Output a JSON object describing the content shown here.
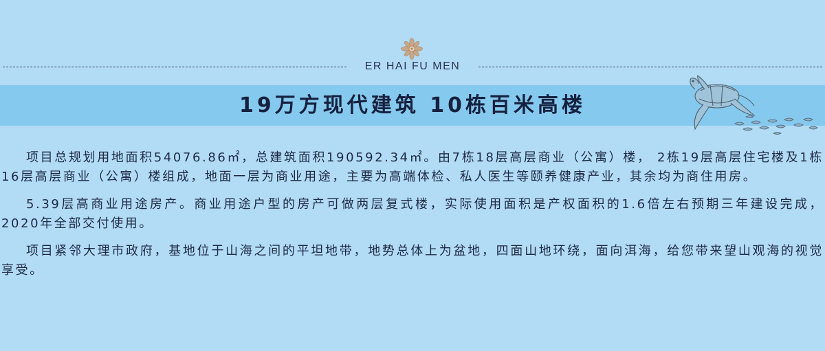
{
  "header": {
    "brand_text": "ER HAI FU MEN",
    "emblem_icon": "lotus-emblem-icon",
    "decoration_icon": "sea-turtle-icon"
  },
  "title_band": {
    "title": "19万方现代建筑  10栋百米高楼"
  },
  "content": {
    "paragraphs": [
      "项目总规划用地面积54076.86㎡，总建筑面积190592.34㎡。由7栋18层高层商业（公寓）楼， 2栋19层高层住宅楼及1栋16层高层商业（公寓）楼组成，地面一层为商业用途，主要为高端体检、私人医生等颐养健康产业，其余均为商住用房。",
      "5.39层高商业用途房产。商业用途户型的房产可做两层复式楼，实际使用面积是产权面积的1.6倍左右预期三年建设完成，2020年全部交付使用。",
      "项目紧邻大理市政府，基地位于山海之间的平坦地带，地势总体上为盆地，四面山地环绕，面向洱海，给您带来望山观海的视觉享受。"
    ]
  },
  "colors": {
    "background": "#b2dbf5",
    "title_band": "#86c9ee",
    "emblem": "#c9a789",
    "text": "#1e2a45"
  }
}
